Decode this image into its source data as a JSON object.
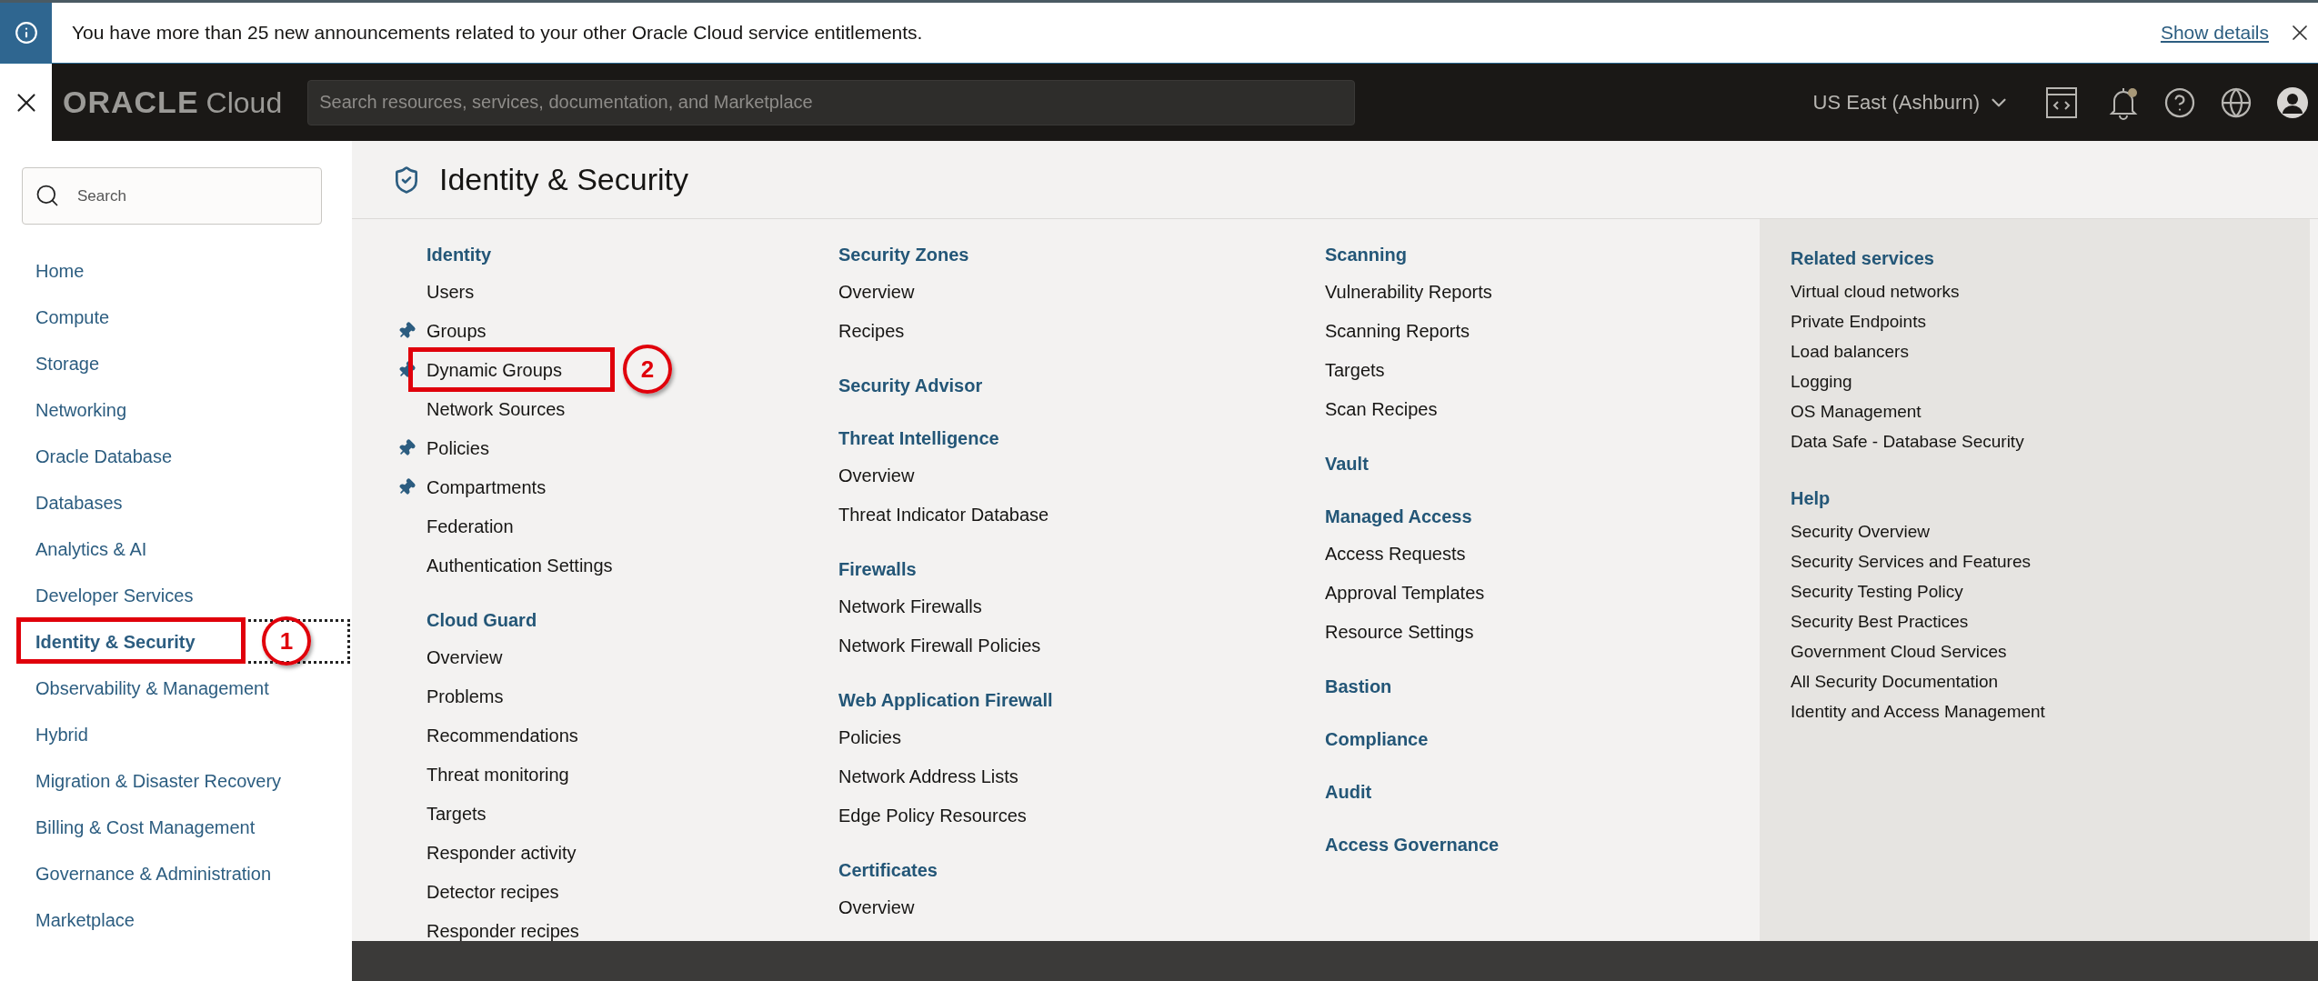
{
  "banner": {
    "text": "You have more than 25 new announcements related to your other Oracle Cloud service entitlements.",
    "link": "Show details"
  },
  "header": {
    "logo_word": "ORACLE",
    "logo_suffix": "Cloud",
    "search_placeholder": "Search resources, services, documentation, and Marketplace",
    "region": "US East (Ashburn)"
  },
  "sidebar": {
    "search_placeholder": "Search",
    "items": [
      {
        "label": "Home",
        "selected": false
      },
      {
        "label": "Compute",
        "selected": false
      },
      {
        "label": "Storage",
        "selected": false
      },
      {
        "label": "Networking",
        "selected": false
      },
      {
        "label": "Oracle Database",
        "selected": false
      },
      {
        "label": "Databases",
        "selected": false
      },
      {
        "label": "Analytics & AI",
        "selected": false
      },
      {
        "label": "Developer Services",
        "selected": false
      },
      {
        "label": "Identity & Security",
        "selected": true,
        "callout": "1"
      },
      {
        "label": "Observability & Management",
        "selected": false
      },
      {
        "label": "Hybrid",
        "selected": false
      },
      {
        "label": "Migration & Disaster Recovery",
        "selected": false
      },
      {
        "label": "Billing & Cost Management",
        "selected": false
      },
      {
        "label": "Governance & Administration",
        "selected": false
      },
      {
        "label": "Marketplace",
        "selected": false
      }
    ]
  },
  "panel": {
    "title": "Identity & Security",
    "columns": [
      [
        {
          "heading": "Identity",
          "items": [
            {
              "label": "Users",
              "pinned": false
            },
            {
              "label": "Groups",
              "pinned": true
            },
            {
              "label": "Dynamic Groups",
              "pinned": true,
              "callout": "2"
            },
            {
              "label": "Network Sources",
              "pinned": false
            },
            {
              "label": "Policies",
              "pinned": true
            },
            {
              "label": "Compartments",
              "pinned": true
            },
            {
              "label": "Federation",
              "pinned": false
            },
            {
              "label": "Authentication Settings",
              "pinned": false
            }
          ]
        },
        {
          "heading": "Cloud Guard",
          "items": [
            {
              "label": "Overview"
            },
            {
              "label": "Problems"
            },
            {
              "label": "Recommendations"
            },
            {
              "label": "Threat monitoring"
            },
            {
              "label": "Targets"
            },
            {
              "label": "Responder activity"
            },
            {
              "label": "Detector recipes"
            },
            {
              "label": "Responder recipes"
            }
          ]
        }
      ],
      [
        {
          "heading": "Security Zones",
          "items": [
            {
              "label": "Overview"
            },
            {
              "label": "Recipes"
            }
          ]
        },
        {
          "heading": "Security Advisor"
        },
        {
          "heading": "Threat Intelligence",
          "items": [
            {
              "label": "Overview"
            },
            {
              "label": "Threat Indicator Database"
            }
          ]
        },
        {
          "heading": "Firewalls",
          "items": [
            {
              "label": "Network Firewalls"
            },
            {
              "label": "Network Firewall Policies"
            }
          ]
        },
        {
          "heading": "Web Application Firewall",
          "items": [
            {
              "label": "Policies"
            },
            {
              "label": "Network Address Lists"
            },
            {
              "label": "Edge Policy Resources"
            }
          ]
        },
        {
          "heading": "Certificates",
          "items": [
            {
              "label": "Overview"
            }
          ]
        }
      ],
      [
        {
          "heading": "Scanning",
          "items": [
            {
              "label": "Vulnerability Reports"
            },
            {
              "label": "Scanning Reports"
            },
            {
              "label": "Targets"
            },
            {
              "label": "Scan Recipes"
            }
          ]
        },
        {
          "heading": "Vault"
        },
        {
          "heading": "Managed Access",
          "items": [
            {
              "label": "Access Requests"
            },
            {
              "label": "Approval Templates"
            },
            {
              "label": "Resource Settings"
            }
          ]
        },
        {
          "heading": "Bastion"
        },
        {
          "heading": "Compliance"
        },
        {
          "heading": "Audit"
        },
        {
          "heading": "Access Governance"
        }
      ]
    ],
    "related": [
      {
        "heading": "Related services",
        "items": [
          "Virtual cloud networks",
          "Private Endpoints",
          "Load balancers",
          "Logging",
          "OS Management",
          "Data Safe - Database Security"
        ]
      },
      {
        "heading": "Help",
        "items": [
          "Security Overview",
          "Security Services and Features",
          "Security Testing Policy",
          "Security Best Practices",
          "Government Cloud Services",
          "All Security Documentation",
          "Identity and Access Management"
        ]
      }
    ]
  }
}
